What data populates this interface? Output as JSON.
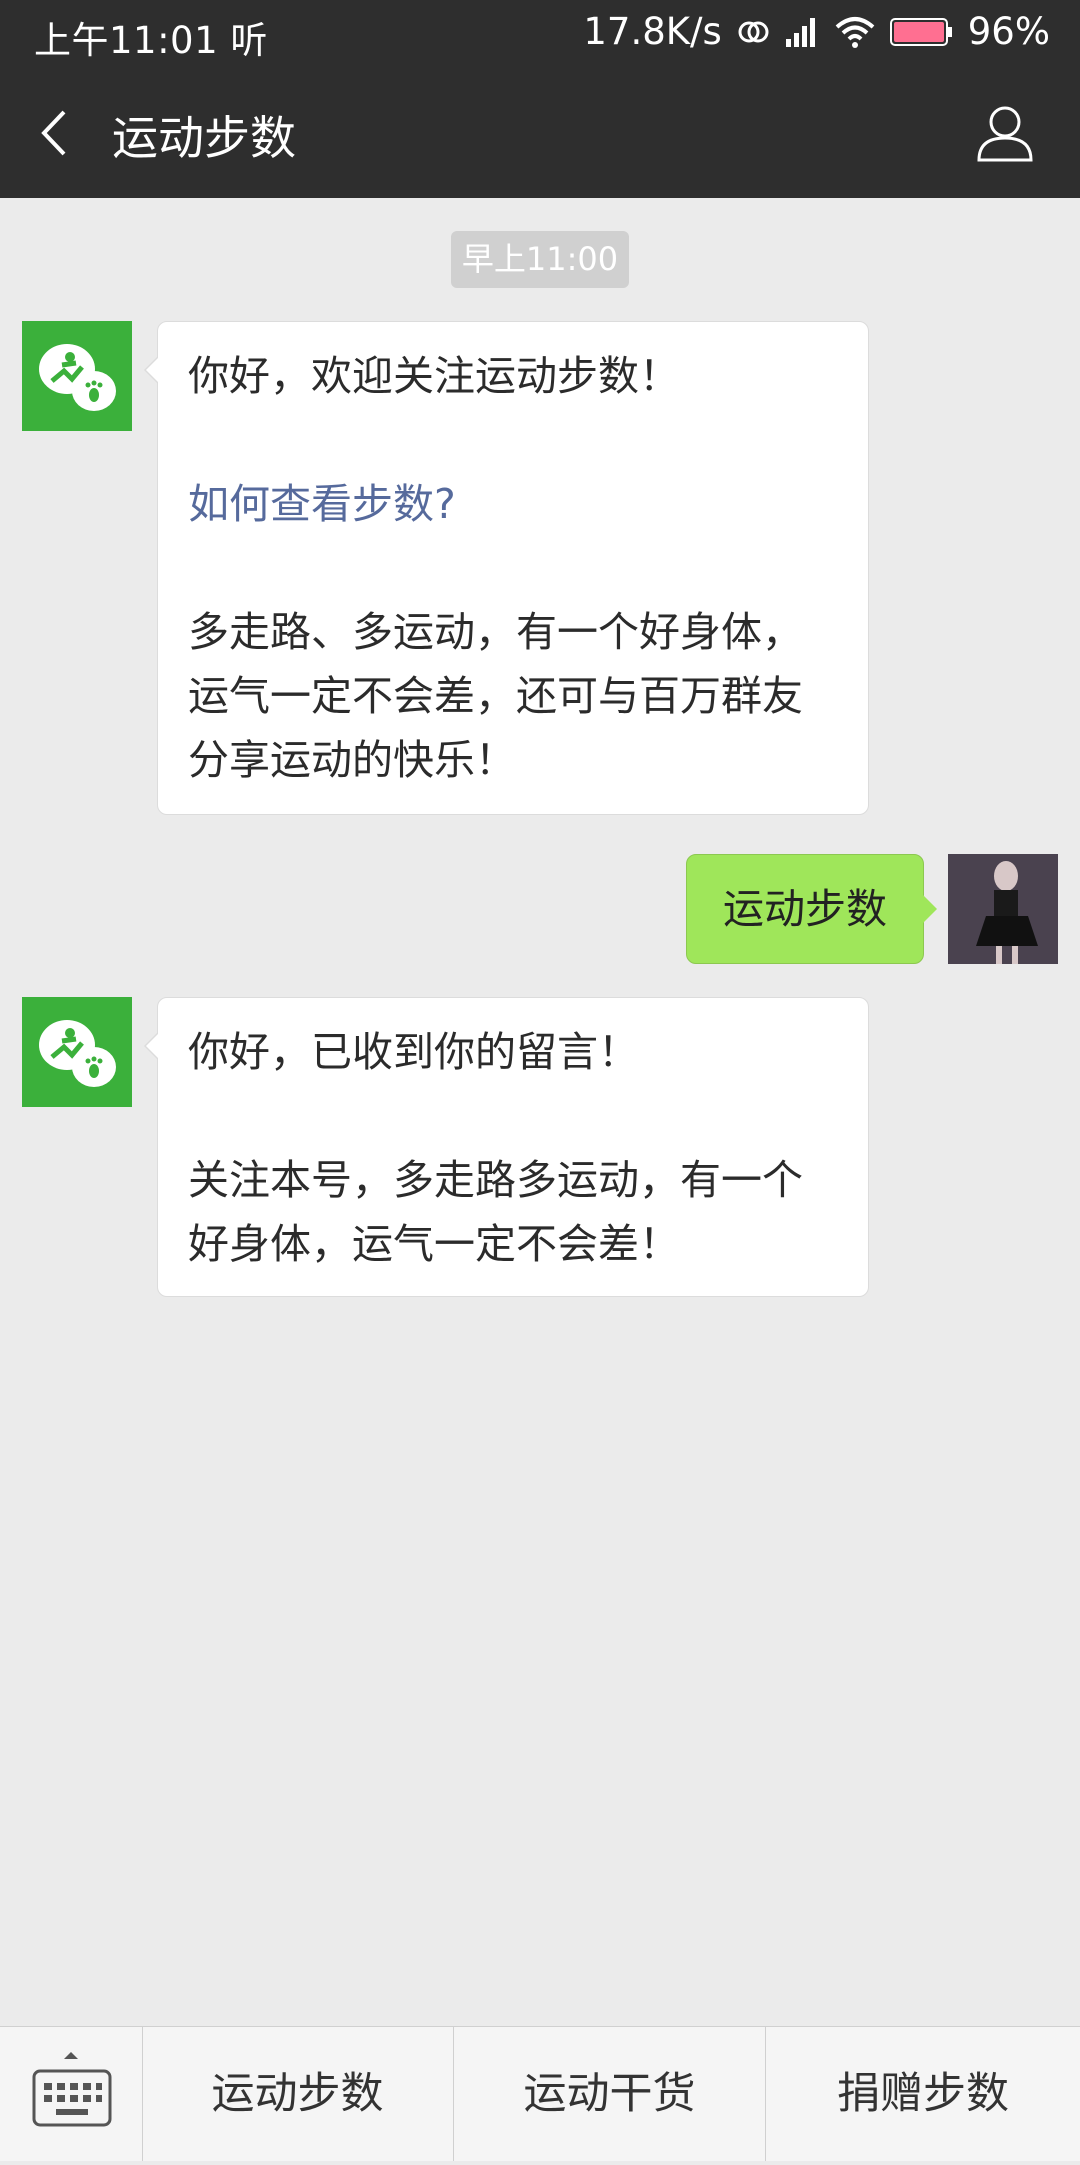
{
  "status_bar": {
    "time": "上午11:01",
    "extra_glyph": "听",
    "speed": "17.8K/s",
    "battery": "96%"
  },
  "nav": {
    "title": "运动步数",
    "back_icon": "chevron-left-icon",
    "profile_icon": "person-icon"
  },
  "chat": {
    "timestamp": "早上11:00",
    "messages": [
      {
        "from": "official",
        "greeting": "你好，欢迎关注运动步数！",
        "link": "如何查看步数?",
        "body": "多走路、多运动，有一个好身体，运气一定不会差，还可与百万群友分享运动的快乐！"
      },
      {
        "from": "me",
        "text": "运动步数"
      },
      {
        "from": "official",
        "greeting": "你好，已收到你的留言！",
        "body": "关注本号，多走路多运动，有一个好身体，运气一定不会差！"
      }
    ]
  },
  "bottom_menu": {
    "keyboard_icon": "keyboard-icon",
    "items": [
      "运动步数",
      "运动干货",
      "捐赠步数"
    ]
  },
  "colors": {
    "header_bg": "#2e2e2e",
    "chat_bg": "#ebebeb",
    "my_bubble": "#9fe65a",
    "avatar_green": "#3bb03b",
    "link": "#566a9c"
  }
}
